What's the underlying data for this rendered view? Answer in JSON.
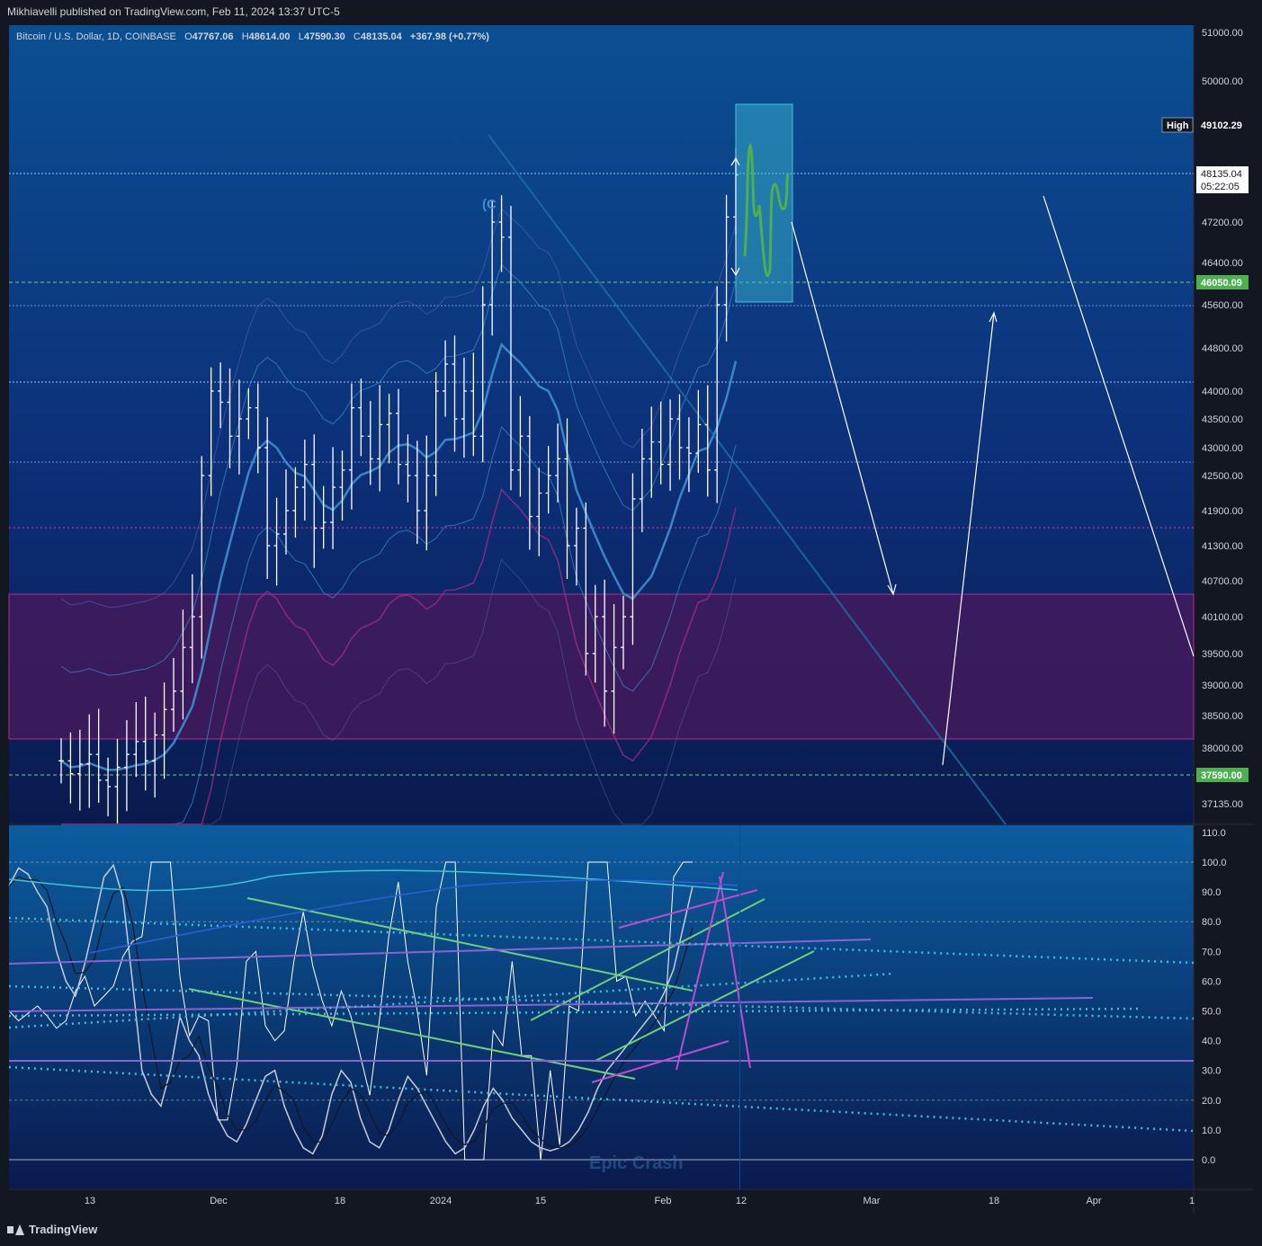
{
  "caption": "Mikhiavelli published on TradingView.com, Feb 11, 2024 13:37 UTC-5",
  "legend": {
    "symbol": "Bitcoin / U.S. Dollar, 1D, COINBASE",
    "o_label": "O",
    "o": "47767.06",
    "h_label": "H",
    "h": "48614.00",
    "l_label": "L",
    "l": "47590.30",
    "c_label": "C",
    "c": "48135.04",
    "change": "+367.98 (+0.77%)"
  },
  "footer": {
    "brand": "TradingView"
  },
  "colors": {
    "background": "#131722",
    "panel_top": "#0b4f93",
    "panel_bottom": "#0a1a4e",
    "purple_zone": "#4a1a5c",
    "cyan_box": "#3fc1d8",
    "green": "#4caf50",
    "bar": "#ffffff",
    "band": "#3f8fd2",
    "magenta": "#b02e8a"
  },
  "chart_data": [
    {
      "type": "line",
      "title": "Bitcoin / U.S. Dollar, 1D, COINBASE",
      "ylim": [
        36800,
        51300
      ],
      "y_ticks": [
        "51000.00",
        "50000.00",
        "47200.00",
        "46400.00",
        "45600.00",
        "44800.00",
        "44000.00",
        "43500.00",
        "43000.00",
        "42500.00",
        "41900.00",
        "41300.00",
        "40700.00",
        "40100.00",
        "39500.00",
        "39000.00",
        "38500.00",
        "38000.00",
        "37135.00"
      ],
      "price_labels": [
        {
          "label": "High",
          "value": "49102.29"
        },
        {
          "label": "",
          "value": "48135.04",
          "sub": "05:22:05"
        },
        {
          "label": "",
          "value": "46050.09"
        },
        {
          "label": "",
          "value": "37590.00"
        }
      ],
      "annotations": [
        "(C"
      ],
      "last_price": 48135.04,
      "demand_zone": [
        38150,
        40450
      ],
      "target_box": [
        46000,
        49550
      ],
      "ohlc_close_sample": [
        37800,
        37600,
        37750,
        37900,
        37500,
        37400,
        37700,
        37900,
        38100,
        37800,
        38200,
        38600,
        38900,
        39600,
        40100,
        42500,
        44000,
        43800,
        43200,
        43500,
        43700,
        43000,
        41300,
        41500,
        41900,
        42300,
        42700,
        41600,
        41700,
        42300,
        42600,
        43700,
        43200,
        42800,
        43400,
        43600,
        42700,
        42500,
        41900,
        42500,
        44000,
        44500,
        43500,
        44000,
        43200,
        45600,
        47200,
        46900,
        42600,
        43200,
        41800,
        42200,
        42500,
        42800,
        41300,
        41600,
        39500,
        40100,
        38900,
        39600,
        40100,
        42100,
        42800,
        43100,
        42700,
        43500,
        43000,
        42900,
        43400,
        42600,
        45600,
        47300,
        48135
      ]
    },
    {
      "type": "line",
      "title": "",
      "ylim": [
        -10,
        110
      ],
      "y_ticks": [
        "110.0",
        "100.0",
        "90.0",
        "80.0",
        "70.0",
        "60.0",
        "50.0",
        "40.0",
        "30.0",
        "20.0",
        "10.0",
        "0.0"
      ],
      "annotations": [
        "Epic Crash"
      ],
      "x_ticks": [
        "13",
        "Dec",
        "18",
        "2024",
        "15",
        "Feb",
        "12",
        "Mar",
        "18",
        "Apr",
        "1"
      ]
    }
  ]
}
